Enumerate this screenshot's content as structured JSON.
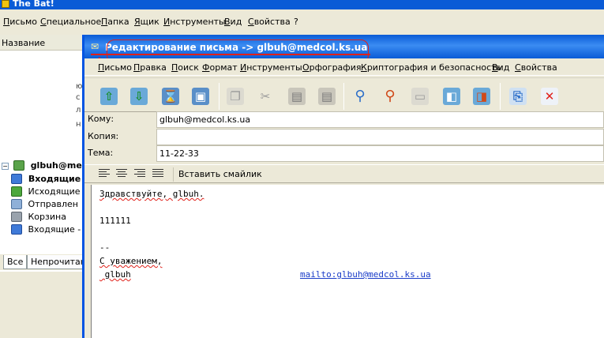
{
  "main_window": {
    "title": "The Bat!",
    "menu": [
      "Письмо",
      "Специальное",
      "Папка",
      "Ящик",
      "Инструменты",
      "Вид",
      "Свойства",
      "?"
    ]
  },
  "folder_panel": {
    "header": "Название",
    "account": "glbuh@medc",
    "folders": [
      {
        "label": "Входящие",
        "icon": "inbox-folder-icon",
        "bold": true
      },
      {
        "label": "Исходящие",
        "icon": "outbox-folder-icon"
      },
      {
        "label": "Отправлен",
        "icon": "sent-folder-icon"
      },
      {
        "label": "Корзина",
        "icon": "trash-folder-icon"
      },
      {
        "label": "Входящие -",
        "icon": "inbox-folder-icon"
      }
    ],
    "tabs": [
      "Все",
      "Непрочитано"
    ]
  },
  "editor": {
    "title": "Редактирование письма -> glbuh@medcol.ks.ua",
    "menu": [
      "Письмо",
      "Правка",
      "Поиск",
      "Формат",
      "Инструменты",
      "Орфография",
      "Криптография и безопасность",
      "Вид",
      "Свойства"
    ],
    "toolbar_icons": [
      "send-icon",
      "queue-icon",
      "send-later-icon",
      "save-draft-icon",
      "copy-icon",
      "cut-icon",
      "paste-icon",
      "paste-quote-icon",
      "find-icon",
      "replace-icon",
      "template-icon",
      "attach-icon",
      "attach-file-icon",
      "undo-icon",
      "cancel-icon"
    ],
    "headers": {
      "to_label": "Кому:",
      "to_value": "glbuh@medcol.ks.ua",
      "cc_label": "Копия:",
      "cc_value": "",
      "subject_label": "Тема:",
      "subject_value": "11-22-33"
    },
    "format_bar": {
      "align_icons": [
        "align-left-icon",
        "align-center-icon",
        "align-right-icon",
        "align-justify-icon"
      ],
      "smiley_button": "Вставить смайлик"
    },
    "body": {
      "greeting": "Здравствуйте, glbuh.",
      "text": "111111",
      "sig_sep": "--",
      "regards": "С уважением,",
      "name": " glbuh",
      "mailto": "mailto:glbuh@medcol.ks.ua"
    }
  },
  "colors": {
    "titlebar": "#0a5bd6",
    "annotation_red": "#e0211a",
    "link_blue": "#1a3cc8"
  }
}
